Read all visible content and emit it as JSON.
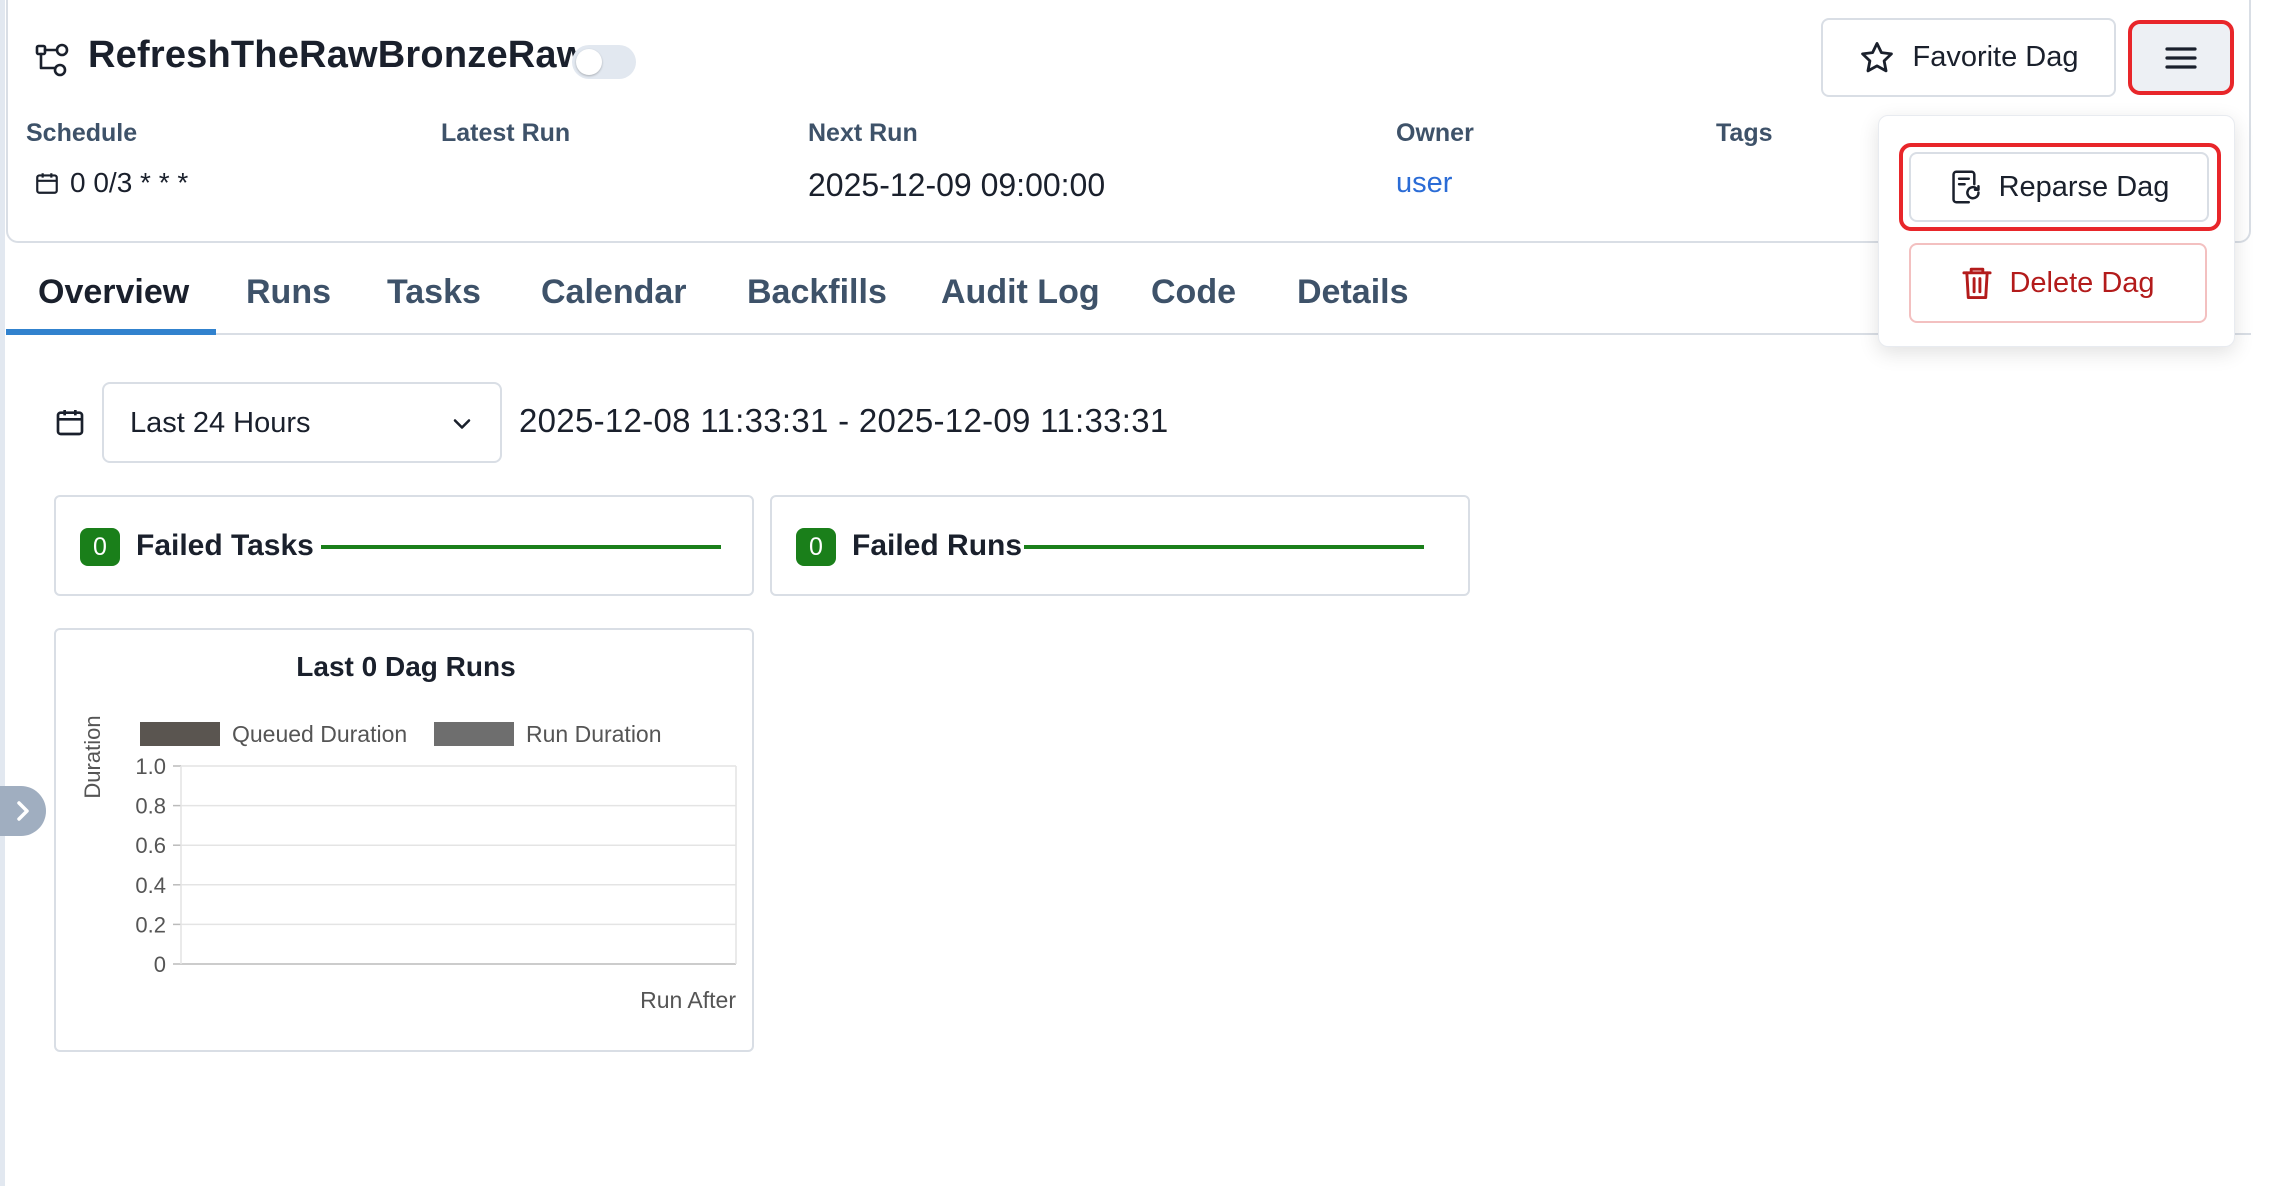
{
  "header": {
    "dag_title": "RefreshTheRawBronzeRaw",
    "favorite_label": "Favorite Dag",
    "meta": {
      "schedule_label": "Schedule",
      "schedule_value": "0 0/3 * * *",
      "latest_run_label": "Latest Run",
      "next_run_label": "Next Run",
      "next_run_value": "2025-12-09 09:00:00",
      "owner_label": "Owner",
      "owner_value": "user",
      "tags_label": "Tags"
    }
  },
  "menu": {
    "reparse_label": "Reparse Dag",
    "delete_label": "Delete Dag"
  },
  "tabs": [
    "Overview",
    "Runs",
    "Tasks",
    "Calendar",
    "Backfills",
    "Audit Log",
    "Code",
    "Details"
  ],
  "filter": {
    "range_selected": "Last 24 Hours",
    "range_text": "2025-12-08 11:33:31 - 2025-12-09 11:33:31"
  },
  "stats": {
    "failed_tasks": {
      "count": "0",
      "label": "Failed Tasks"
    },
    "failed_runs": {
      "count": "0",
      "label": "Failed Runs"
    }
  },
  "colors": {
    "accent": "#3182ce",
    "success": "#1a7f1a",
    "danger": "#b31b1b",
    "highlight": "#e8262a",
    "link": "#2b6cd6"
  },
  "chart_data": {
    "type": "bar",
    "title": "Last 0 Dag Runs",
    "ylabel": "Duration",
    "xlabel": "Run After",
    "ylim": [
      0,
      1
    ],
    "yticks": [
      "1.0",
      "0.8",
      "0.6",
      "0.4",
      "0.2",
      "0"
    ],
    "categories": [],
    "series": [
      {
        "name": "Queued Duration",
        "color": "#5a5550",
        "values": []
      },
      {
        "name": "Run Duration",
        "color": "#6e6e6e",
        "values": []
      }
    ],
    "grid": true,
    "legend": "top"
  }
}
